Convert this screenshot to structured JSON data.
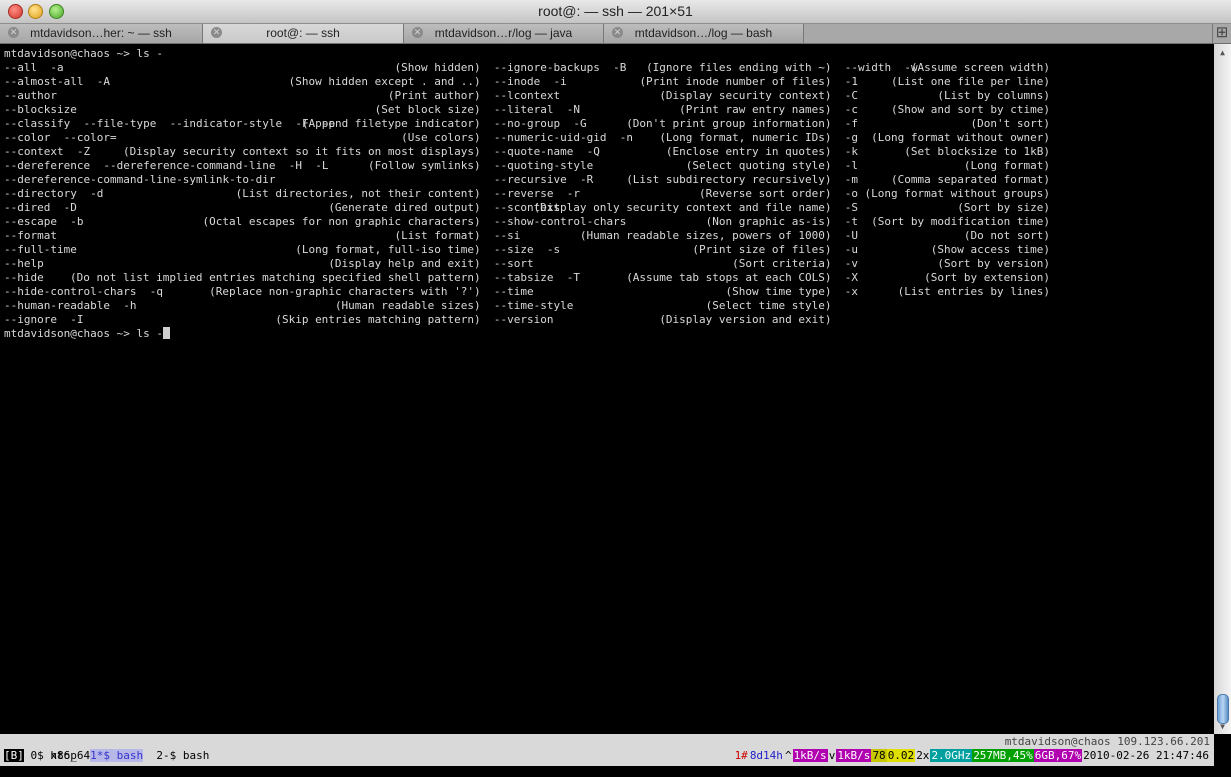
{
  "window": {
    "title": "root@: — ssh — 201×51"
  },
  "tabs": [
    {
      "label": "mtdavidson…her: ~ — ssh",
      "active": false
    },
    {
      "label": "root@: — ssh",
      "active": true
    },
    {
      "label": "mtdavidson…r/log — java",
      "active": false
    },
    {
      "label": "mtdavidson…/log — bash",
      "active": false
    }
  ],
  "terminal": {
    "prompt_line": "mtdavidson@chaos ~> ls -",
    "options": [
      {
        "col1_opt": "--all  -a",
        "col1_desc": "(Show hidden)",
        "col2_opt": "--ignore-backups  -B",
        "col2_desc": "(Ignore files ending with ~)",
        "col3_opt": "--width  -w",
        "col3_desc": "(Assume screen width)"
      },
      {
        "col1_opt": "--almost-all  -A",
        "col1_desc": "(Show hidden except . and ..)",
        "col2_opt": "--inode  -i",
        "col2_desc": "(Print inode number of files)",
        "col3_opt": "-1",
        "col3_desc": "(List one file per line)"
      },
      {
        "col1_opt": "--author",
        "col1_desc": "(Print author)",
        "col2_opt": "--lcontext",
        "col2_desc": "(Display security context)",
        "col3_opt": "-C",
        "col3_desc": "(List by columns)"
      },
      {
        "col1_opt": "--blocksize",
        "col1_desc": "(Set block size)",
        "col2_opt": "--literal  -N",
        "col2_desc": "(Print raw entry names)",
        "col3_opt": "-c",
        "col3_desc": "(Show and sort by ctime)"
      },
      {
        "col1_opt": "--classify  --file-type  --indicator-style  -F  -p",
        "col1_desc": "(Append filetype indicator)",
        "col2_opt": "--no-group  -G",
        "col2_desc": "(Don't print group information)",
        "col3_opt": "-f",
        "col3_desc": "(Don't sort)"
      },
      {
        "col1_opt": "--color  --color=",
        "col1_desc": "(Use colors)",
        "col2_opt": "--numeric-uid-gid  -n",
        "col2_desc": "(Long format, numeric IDs)",
        "col3_opt": "-g",
        "col3_desc": "(Long format without owner)"
      },
      {
        "col1_opt": "--context  -Z",
        "col1_desc": "(Display security context so it fits on most displays)",
        "col2_opt": "--quote-name  -Q",
        "col2_desc": "(Enclose entry in quotes)",
        "col3_opt": "-k",
        "col3_desc": "(Set blocksize to 1kB)"
      },
      {
        "col1_opt": "--dereference  --dereference-command-line  -H  -L",
        "col1_desc": "(Follow symlinks)",
        "col2_opt": "--quoting-style",
        "col2_desc": "(Select quoting style)",
        "col3_opt": "-l",
        "col3_desc": "(Long format)"
      },
      {
        "col1_opt": "--dereference-command-line-symlink-to-dir",
        "col1_desc": "",
        "col2_opt": "--recursive  -R",
        "col2_desc": "(List subdirectory recursively)",
        "col3_opt": "-m",
        "col3_desc": "(Comma separated format)"
      },
      {
        "col1_opt": "--directory  -d",
        "col1_desc": "(List directories, not their content)",
        "col2_opt": "--reverse  -r",
        "col2_desc": "(Reverse sort order)",
        "col3_opt": "-o",
        "col3_desc": "(Long format without groups)"
      },
      {
        "col1_opt": "--dired  -D",
        "col1_desc": "(Generate dired output)",
        "col2_opt": "--scontext",
        "col2_desc": "(Display only security context and file name)",
        "col3_opt": "-S",
        "col3_desc": "(Sort by size)"
      },
      {
        "col1_opt": "--escape  -b",
        "col1_desc": "(Octal escapes for non graphic characters)",
        "col2_opt": "--show-control-chars",
        "col2_desc": "(Non graphic as-is)",
        "col3_opt": "-t",
        "col3_desc": "(Sort by modification time)"
      },
      {
        "col1_opt": "--format",
        "col1_desc": "(List format)",
        "col2_opt": "--si",
        "col2_desc": "(Human readable sizes, powers of 1000)",
        "col3_opt": "-U",
        "col3_desc": "(Do not sort)"
      },
      {
        "col1_opt": "--full-time",
        "col1_desc": "(Long format, full-iso time)",
        "col2_opt": "--size  -s",
        "col2_desc": "(Print size of files)",
        "col3_opt": "-u",
        "col3_desc": "(Show access time)"
      },
      {
        "col1_opt": "--help",
        "col1_desc": "(Display help and exit)",
        "col2_opt": "--sort",
        "col2_desc": "(Sort criteria)",
        "col3_opt": "-v",
        "col3_desc": "(Sort by version)"
      },
      {
        "col1_opt": "--hide",
        "col1_desc": "(Do not list implied entries matching specified shell pattern)",
        "col2_opt": "--tabsize  -T",
        "col2_desc": "(Assume tab stops at each COLS)",
        "col3_opt": "-X",
        "col3_desc": "(Sort by extension)"
      },
      {
        "col1_opt": "--hide-control-chars  -q",
        "col1_desc": "(Replace non-graphic characters with '?')",
        "col2_opt": "--time",
        "col2_desc": "(Show time type)",
        "col3_opt": "-x",
        "col3_desc": "(List entries by lines)"
      },
      {
        "col1_opt": "--human-readable  -h",
        "col1_desc": "(Human readable sizes)",
        "col2_opt": "--time-style",
        "col2_desc": "(Select time style)",
        "col3_opt": "",
        "col3_desc": ""
      },
      {
        "col1_opt": "--ignore  -I",
        "col1_desc": "(Skip entries matching pattern)",
        "col2_opt": "--version",
        "col2_desc": "(Display version and exit)",
        "col3_opt": "",
        "col3_desc": ""
      }
    ],
    "current_prompt": "mtdavidson@chaos ~> ",
    "current_command": "ls -"
  },
  "screen_status": {
    "windows": [
      {
        "label": "0$ htop",
        "active": false
      },
      {
        "label": "1*$ bash",
        "active": true
      },
      {
        "label": "2-$ bash",
        "active": false
      }
    ],
    "host": "mtdavidson@chaos 109.123.66.201",
    "bottom_left": "[B]",
    "arch": "x86_64",
    "segments": [
      {
        "text": "1#",
        "color": "#cc0000",
        "bg": "#d9d9d9"
      },
      {
        "text": "8d14h",
        "color": "#2222cc",
        "bg": "#d9d9d9"
      },
      {
        "text": "^",
        "color": "#000000",
        "bg": "#d9d9d9"
      },
      {
        "text": "1kB/s",
        "color": "#ffffff",
        "bg": "#b000b0"
      },
      {
        "text": "v",
        "color": "#000000",
        "bg": "#d9d9d9"
      },
      {
        "text": "1kB/s",
        "color": "#ffffff",
        "bg": "#b000b0"
      },
      {
        "text": "78",
        "color": "#000000",
        "bg": "#c8c800"
      },
      {
        "text": "0.02",
        "color": "#000000",
        "bg": "#e0e000"
      },
      {
        "text": "2x",
        "color": "#000000",
        "bg": "#d9d9d9"
      },
      {
        "text": "2.0GHz",
        "color": "#ffffff",
        "bg": "#00a0a0"
      },
      {
        "text": "257MB,45%",
        "color": "#ffffff",
        "bg": "#00a000"
      },
      {
        "text": "6GB,67%",
        "color": "#ffffff",
        "bg": "#b000b0"
      },
      {
        "text": "2010-02-26 21:47:46",
        "color": "#000000",
        "bg": "#d9d9d9"
      }
    ]
  }
}
